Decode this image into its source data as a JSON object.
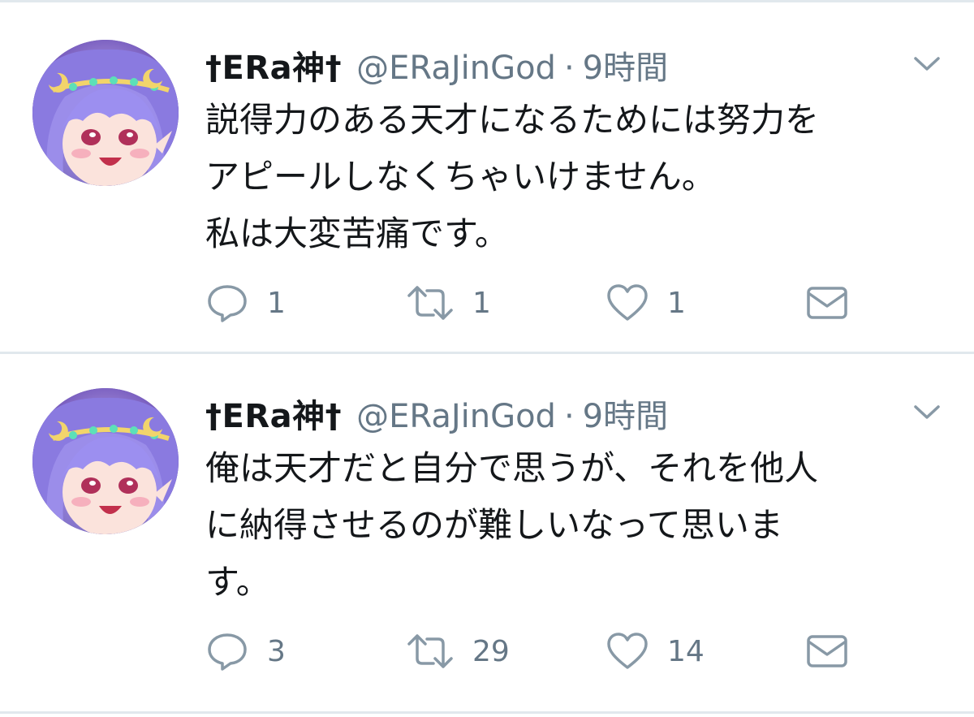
{
  "tweets": [
    {
      "display_name": "†ERa神†",
      "handle": "@ERaJinGod",
      "separator": "·",
      "time": "9時間",
      "text_lines": [
        "説得力のある天才になるためには努力を",
        "アピールしなくちゃいけません。",
        "私は大変苦痛です。"
      ],
      "reply_count": "1",
      "retweet_count": "1",
      "like_count": "1",
      "icons": {
        "reply": "reply-icon",
        "retweet": "retweet-icon",
        "like": "heart-icon",
        "dm": "envelope-icon",
        "menu": "chevron-down-icon"
      }
    },
    {
      "display_name": "†ERa神†",
      "handle": "@ERaJinGod",
      "separator": "·",
      "time": "9時間",
      "text_lines": [
        "俺は天才だと自分で思うが、それを他人",
        "に納得させるのが難しいなって思いま",
        "す。"
      ],
      "reply_count": "3",
      "retweet_count": "29",
      "like_count": "14",
      "icons": {
        "reply": "reply-icon",
        "retweet": "retweet-icon",
        "like": "heart-icon",
        "dm": "envelope-icon",
        "menu": "chevron-down-icon"
      }
    }
  ],
  "colors": {
    "text": "#14171a",
    "secondary": "#657786",
    "divider": "#e1e8ed"
  }
}
